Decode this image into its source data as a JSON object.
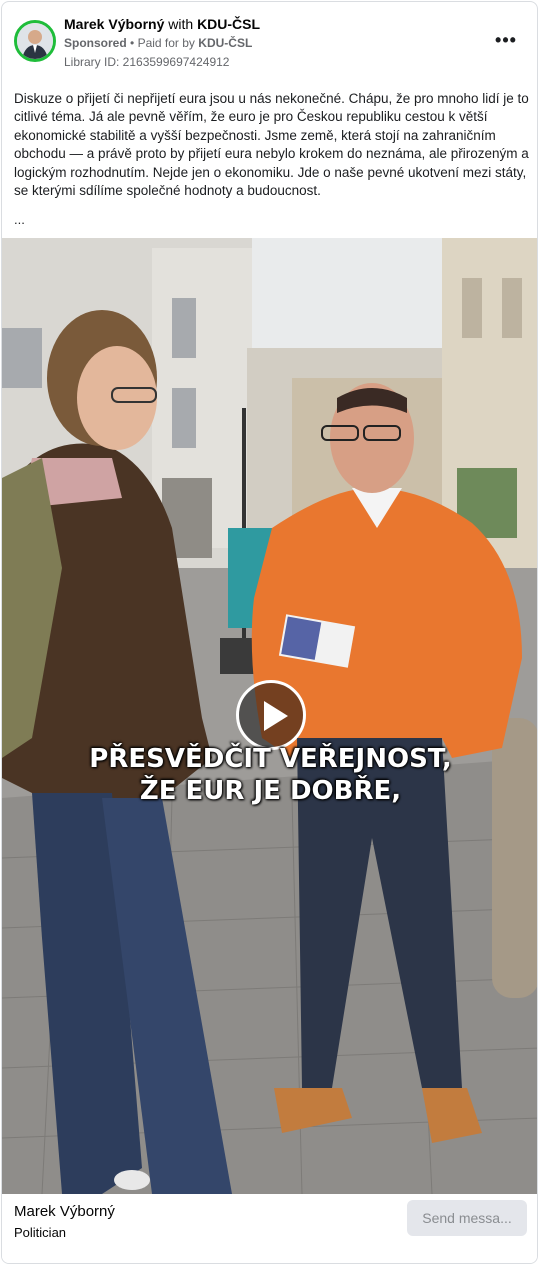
{
  "header": {
    "name": "Marek Výborný",
    "with_text": "with",
    "partner": "KDU-ČSL",
    "sponsored": "Sponsored",
    "bullet": "•",
    "paid_for_by": "Paid for by",
    "payer": "KDU-ČSL",
    "library_id": "Library ID: 2163599697424912",
    "more_icon": "more-horizontal-icon",
    "avatar_ring_color": "#1fbd3a"
  },
  "post": {
    "text": "Diskuze o přijetí či nepřijetí eura jsou u nás nekonečné. Chápu, že pro mnoho lidí je to citlivé téma. Já ale pevně věřím, že euro je pro Českou republiku cestou k větší ekonomické stabilitě a vyšší bezpečnosti. Jsme země, která stojí na zahraničním obchodu — a právě proto by přijetí eura nebylo krokem do neznáma, ale přirozeným a logickým rozhodnutím. Nejde jen o ekonomiku. Jde o naše pevné ukotvení mezi státy, se kterými sdílíme společné hodnoty a budoucnost.",
    "truncation": "..."
  },
  "video": {
    "play_icon": "play-icon",
    "subtitle_line1": "PŘESVĚDČIT VEŘEJNOST,",
    "subtitle_line2": "ŽE EUR JE DOBŘE,"
  },
  "footer": {
    "page_name": "Marek Výborný",
    "category": "Politician",
    "cta_label": "Send messa..."
  }
}
